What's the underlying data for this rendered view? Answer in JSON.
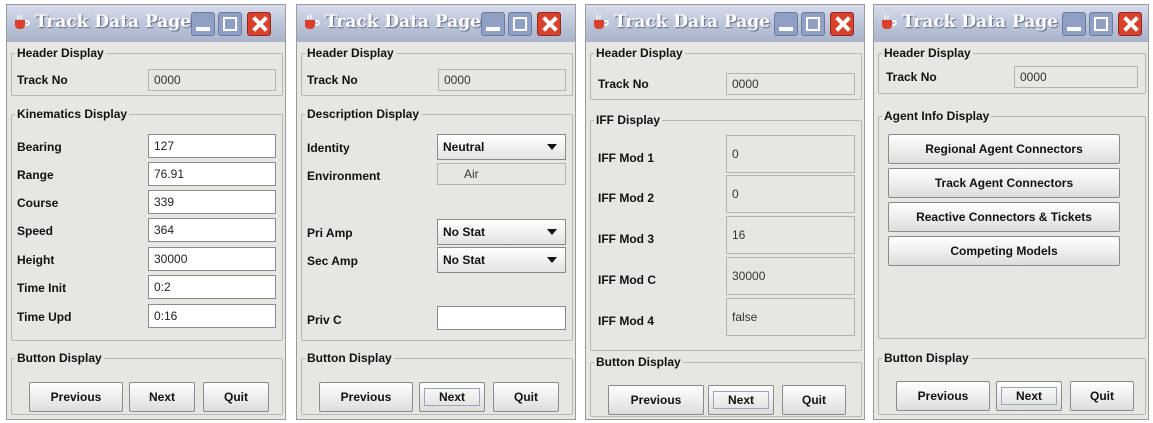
{
  "windows": [
    {
      "title": "Track Data Page",
      "header": {
        "legend": "Header Display",
        "track_label": "Track No",
        "track_value": "0000"
      },
      "kinematics": {
        "legend": "Kinematics Display",
        "fields": [
          {
            "label": "Bearing",
            "value": "127"
          },
          {
            "label": "Range",
            "value": "76.91"
          },
          {
            "label": "Course",
            "value": "339"
          },
          {
            "label": "Speed",
            "value": "364"
          },
          {
            "label": "Height",
            "value": "30000"
          },
          {
            "label": "Time Init",
            "value": "0:2"
          },
          {
            "label": "Time Upd",
            "value": "0:16"
          }
        ]
      },
      "buttons": {
        "legend": "Button Display",
        "previous": "Previous",
        "next": "Next",
        "quit": "Quit"
      }
    },
    {
      "title": "Track Data Page",
      "header": {
        "legend": "Header Display",
        "track_label": "Track No",
        "track_value": "0000"
      },
      "description": {
        "legend": "Description Display",
        "identity_label": "Identity",
        "identity_value": "Neutral",
        "environment_label": "Environment",
        "environment_value": "Air",
        "pri_amp_label": "Pri Amp",
        "pri_amp_value": "No Stat",
        "sec_amp_label": "Sec Amp",
        "sec_amp_value": "No Stat",
        "priv_c_label": "Priv C",
        "priv_c_value": ""
      },
      "buttons": {
        "legend": "Button Display",
        "previous": "Previous",
        "next": "Next",
        "quit": "Quit"
      }
    },
    {
      "title": "Track Data Page",
      "header": {
        "legend": "Header Display",
        "track_label": "Track No",
        "track_value": "0000"
      },
      "iff": {
        "legend": "IFF Display",
        "fields": [
          {
            "label": "IFF Mod 1",
            "value": "0"
          },
          {
            "label": "IFF Mod 2",
            "value": "0"
          },
          {
            "label": "IFF Mod 3",
            "value": "16"
          },
          {
            "label": "IFF Mod C",
            "value": "30000"
          },
          {
            "label": "IFF Mod 4",
            "value": "false"
          }
        ]
      },
      "buttons": {
        "legend": "Button Display",
        "previous": "Previous",
        "next": "Next",
        "quit": "Quit"
      }
    },
    {
      "title": "Track Data Page",
      "header": {
        "legend": "Header Display",
        "track_label": "Track No",
        "track_value": "0000"
      },
      "agent": {
        "legend": "Agent Info Display",
        "buttons": [
          "Regional Agent Connectors",
          "Track Agent Connectors",
          "Reactive Connectors & Tickets",
          "Competing Models"
        ]
      },
      "buttons": {
        "legend": "Button Display",
        "previous": "Previous",
        "next": "Next",
        "quit": "Quit"
      }
    }
  ],
  "colors": {
    "window_bg": "#e6e6e3",
    "titlebar": "#b9c1d6",
    "close_button": "#d9412e"
  },
  "icons": {
    "app": "java-cup-icon",
    "minimize": "minimize-icon",
    "maximize": "maximize-icon",
    "close": "close-icon"
  }
}
